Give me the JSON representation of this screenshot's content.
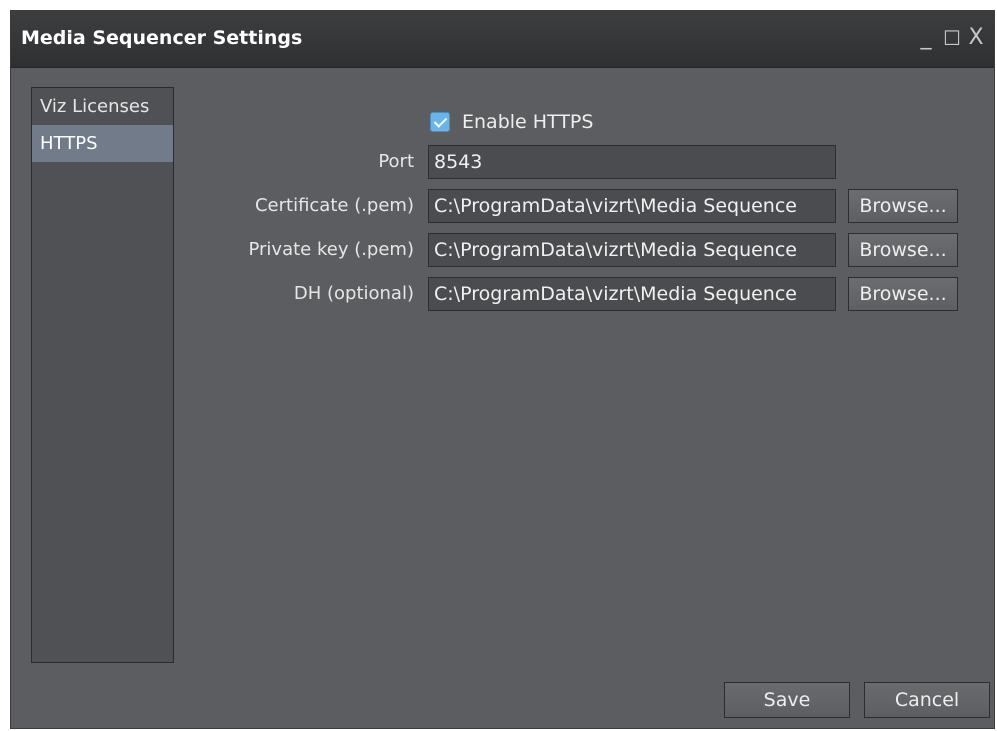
{
  "window": {
    "title": "Media Sequencer Settings",
    "controls": {
      "minimize": "_",
      "maximize": "☐",
      "close": "X"
    }
  },
  "sidebar": {
    "items": [
      {
        "label": "Viz Licenses",
        "active": false
      },
      {
        "label": "HTTPS",
        "active": true
      }
    ]
  },
  "https": {
    "enable_label": "Enable HTTPS",
    "enabled": true,
    "fields": [
      {
        "label": "Port",
        "value": "8543"
      },
      {
        "label": "Certificate (.pem)",
        "value": "C:\\ProgramData\\vizrt\\Media Sequence"
      },
      {
        "label": "Private key (.pem)",
        "value": "C:\\ProgramData\\vizrt\\Media Sequence"
      },
      {
        "label": "DH (optional)",
        "value": "C:\\ProgramData\\vizrt\\Media Sequence"
      }
    ],
    "browse_label": "Browse..."
  },
  "footer": {
    "save_label": "Save",
    "cancel_label": "Cancel"
  },
  "colors": {
    "background": "#5b5d60",
    "titlebar": "#2f3031",
    "accent": "#6ab4e8",
    "selected": "#717b8a"
  }
}
